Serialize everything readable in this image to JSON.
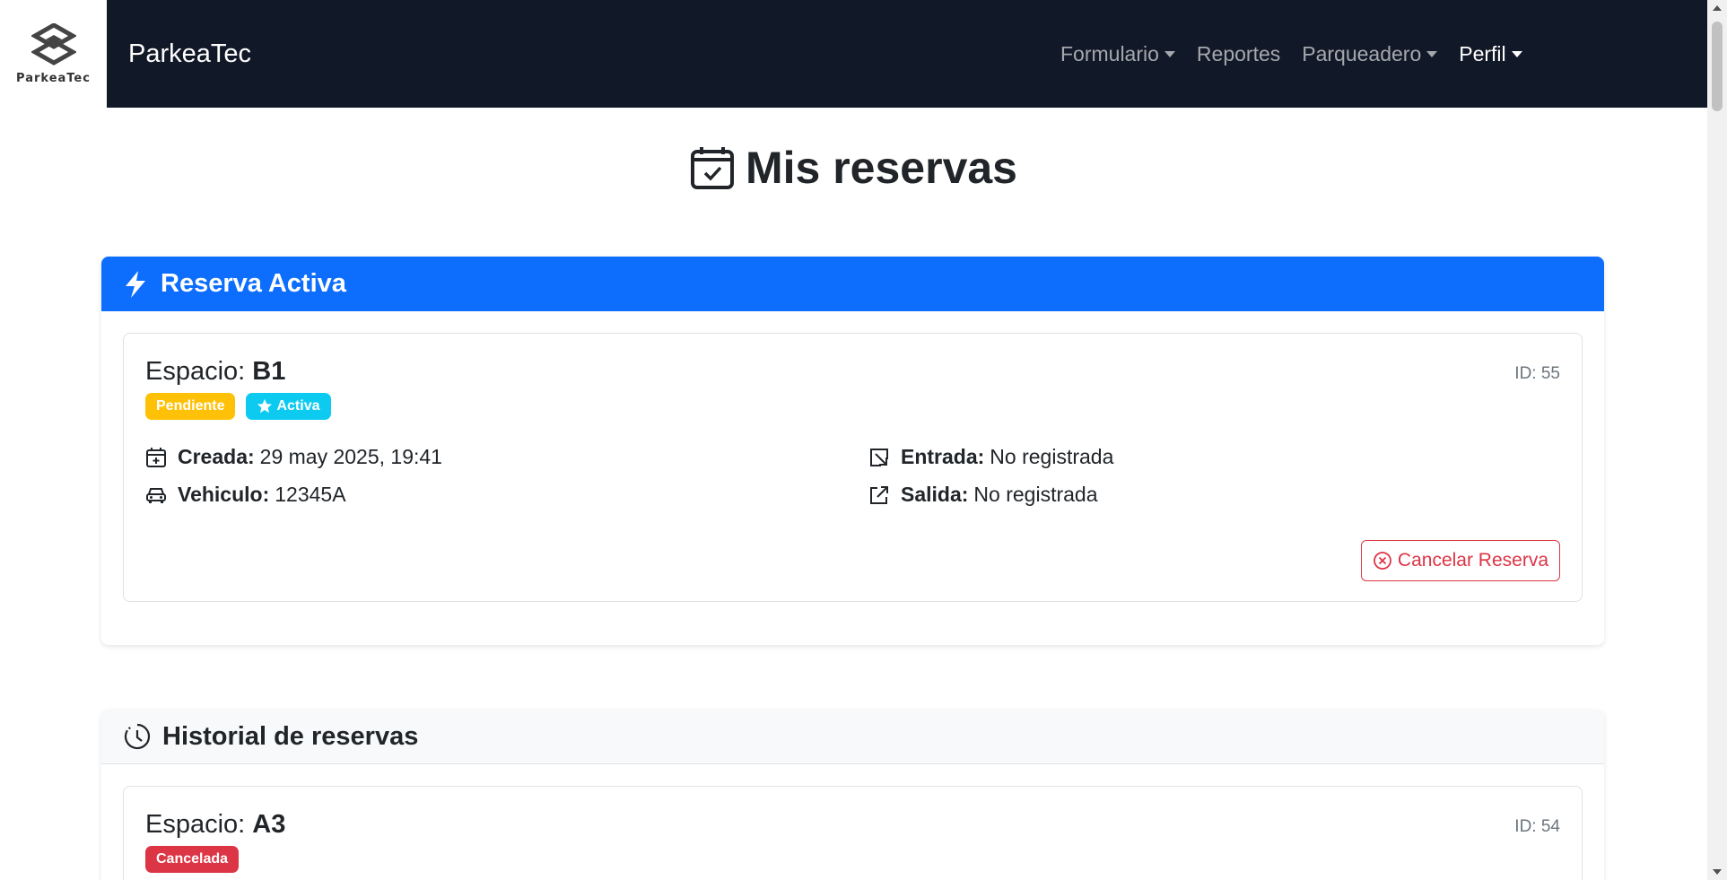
{
  "navbar": {
    "logo_text": "ParkeaTec",
    "brand": "ParkeaTec",
    "links": [
      {
        "label": "Formulario",
        "dropdown": true
      },
      {
        "label": "Reportes",
        "dropdown": false
      },
      {
        "label": "Parqueadero",
        "dropdown": true
      },
      {
        "label": "Perfil",
        "dropdown": true
      }
    ]
  },
  "page": {
    "title": "Mis reservas",
    "title_icon": "calendar-check-icon"
  },
  "active_section": {
    "header": "Reserva Activa",
    "header_icon": "lightning-icon",
    "reservation": {
      "space_label": "Espacio:",
      "space": "B1",
      "id": "ID: 55",
      "badges": [
        "Pendiente",
        "Activa"
      ],
      "created_label": "Creada:",
      "created": "29 may 2025, 19:41",
      "vehicle_label": "Vehiculo:",
      "vehicle": "12345A",
      "entry_label": "Entrada:",
      "entry": "No registrada",
      "exit_label": "Salida:",
      "exit": "No registrada",
      "cancel_label": "Cancelar Reserva"
    }
  },
  "history_section": {
    "header": "Historial de reservas",
    "header_icon": "clock-history-icon",
    "items": [
      {
        "space_label": "Espacio:",
        "space": "A3",
        "id": "ID: 54",
        "badge": "Cancelada"
      }
    ]
  },
  "colors": {
    "navbar": "#111827",
    "primary": "#0d6efd",
    "warning": "#ffc107",
    "info": "#0dcaf0",
    "danger": "#dc3545"
  }
}
